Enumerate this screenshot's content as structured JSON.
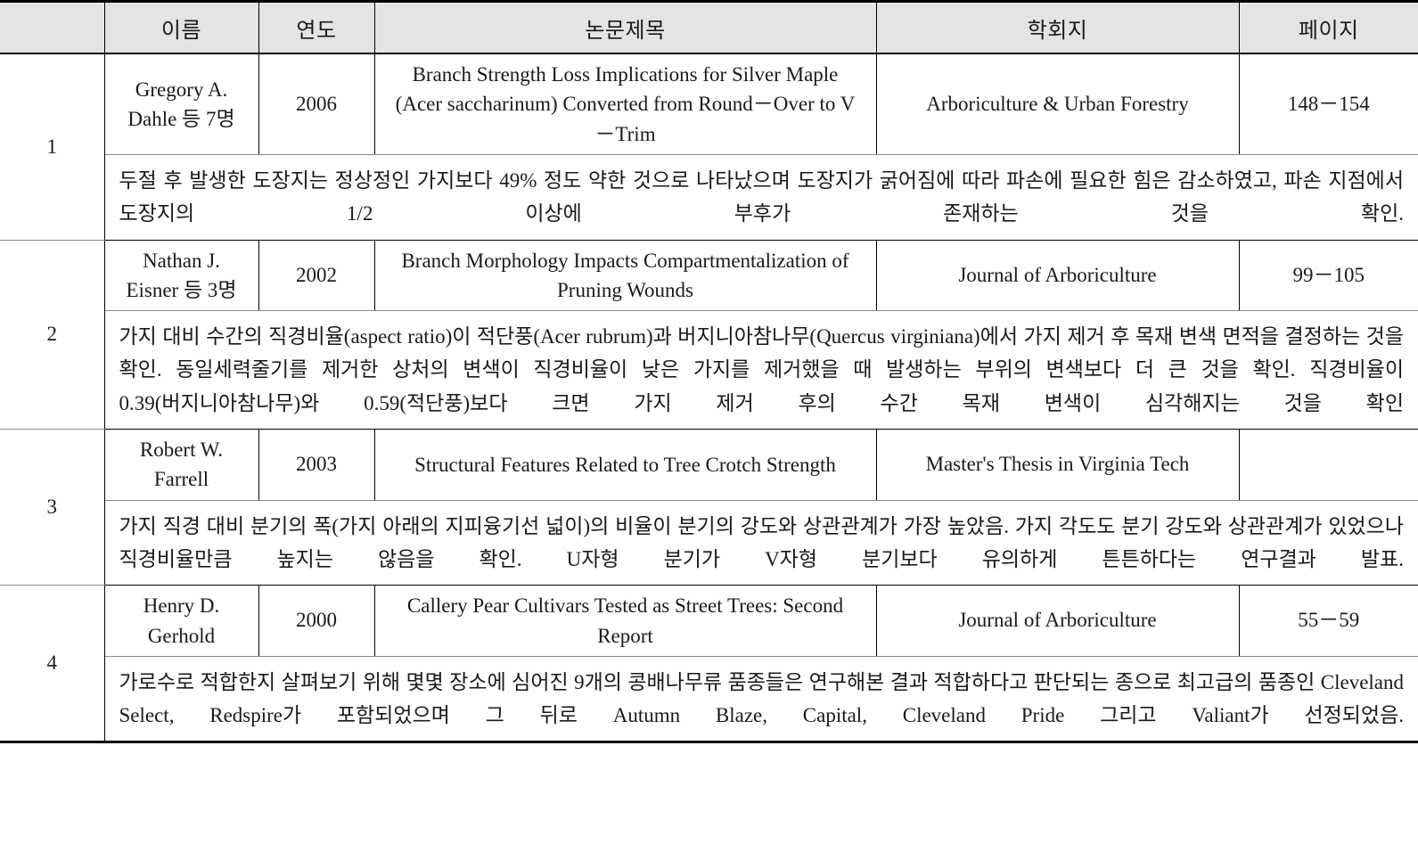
{
  "table": {
    "headers": {
      "no": "",
      "name": "이름",
      "year": "연도",
      "title": "논문제목",
      "journal": "학회지",
      "pages": "페이지"
    },
    "rows": [
      {
        "no": "1",
        "name": "Gregory A.\nDahle 등 7명",
        "year": "2006",
        "title": "Branch Strength Loss Implications for Silver Maple (Acer saccharinum) Converted from Round－Over to V－Trim",
        "journal": "Arboriculture & Urban Forestry",
        "pages": "148－154",
        "summary": "두절 후 발생한 도장지는 정상정인 가지보다 49% 정도 약한 것으로 나타났으며 도장지가 굵어짐에 따라 파손에 필요한 힘은 감소하였고, 파손 지점에서 도장지의 1/2 이상에 부후가 존재하는 것을 확인."
      },
      {
        "no": "2",
        "name": "Nathan J.\nEisner 등 3명",
        "year": "2002",
        "title": "Branch Morphology Impacts Compartmentalization of Pruning Wounds",
        "journal": "Journal of Arboriculture",
        "pages": "99－105",
        "summary": "가지 대비 수간의 직경비율(aspect ratio)이 적단풍(Acer rubrum)과 버지니아참나무(Quercus virginiana)에서 가지 제거 후 목재 변색 면적을 결정하는 것을 확인. 동일세력줄기를 제거한 상처의 변색이 직경비율이 낮은 가지를 제거했을 때 발생하는 부위의 변색보다 더 큰 것을 확인. 직경비율이 0.39(버지니아참나무)와 0.59(적단풍)보다 크면 가지 제거 후의 수간 목재 변색이 심각해지는 것을 확인"
      },
      {
        "no": "3",
        "name": "Robert W.\nFarrell",
        "year": "2003",
        "title": "Structural Features Related to Tree Crotch Strength",
        "journal": "Master's Thesis in Virginia Tech",
        "pages": "",
        "summary": "가지 직경 대비 분기의 폭(가지 아래의 지피융기선 넓이)의 비율이 분기의 강도와 상관관계가 가장 높았음. 가지 각도도 분기 강도와 상관관계가 있었으나 직경비율만큼 높지는 않음을 확인. U자형 분기가 V자형 분기보다 유의하게 튼튼하다는 연구결과 발표."
      },
      {
        "no": "4",
        "name": "Henry D.\nGerhold",
        "year": "2000",
        "title": "Callery Pear Cultivars Tested as Street Trees: Second Report",
        "journal": "Journal of Arboriculture",
        "pages": "55－59",
        "summary": "가로수로 적합한지 살펴보기 위해 몇몇 장소에 심어진 9개의 콩배나무류 품종들은 연구해본 결과 적합하다고 판단되는 종으로 최고급의 품종인 Cleveland Select, Redspire가 포함되었으며 그 뒤로 Autumn Blaze, Capital, Cleveland Pride 그리고 Valiant가 선정되었음."
      }
    ]
  }
}
